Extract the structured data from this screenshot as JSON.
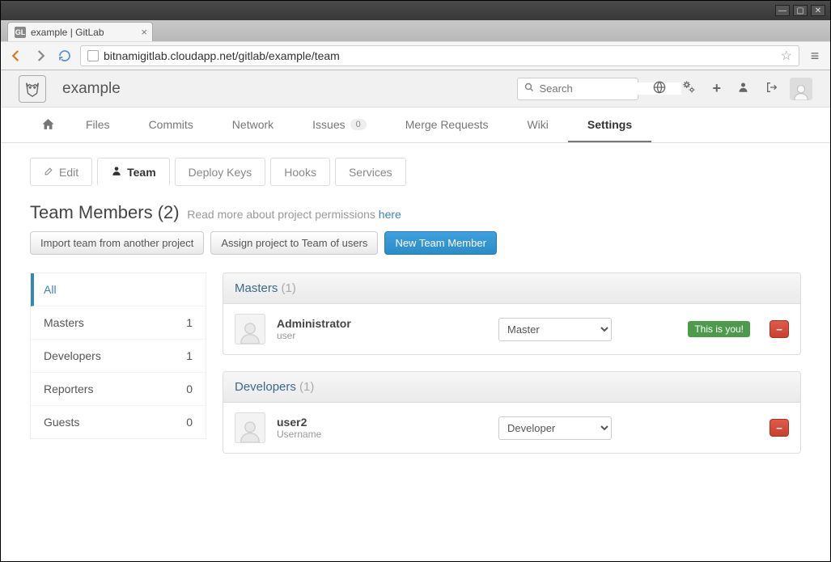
{
  "browser": {
    "tab_title": "example | GitLab",
    "favicon_text": "GL",
    "url_display": "bitnamigitlab.cloudapp.net/gitlab/example/team"
  },
  "header": {
    "project_name": "example",
    "search_placeholder": "Search"
  },
  "nav": {
    "items": [
      "Files",
      "Commits",
      "Network",
      "Issues",
      "Merge Requests",
      "Wiki",
      "Settings"
    ],
    "issues_count": "0",
    "active": "Settings"
  },
  "subtabs": {
    "edit": "Edit",
    "team": "Team",
    "deploy_keys": "Deploy Keys",
    "hooks": "Hooks",
    "services": "Services"
  },
  "heading": {
    "title": "Team Members",
    "count": "(2)",
    "hint_prefix": "Read more about project permissions ",
    "hint_link": "here"
  },
  "buttons": {
    "import": "Import team from another project",
    "assign": "Assign project to Team of users",
    "new_member": "New Team Member"
  },
  "sidebar": {
    "items": [
      {
        "label": "All",
        "count": ""
      },
      {
        "label": "Masters",
        "count": "1"
      },
      {
        "label": "Developers",
        "count": "1"
      },
      {
        "label": "Reporters",
        "count": "0"
      },
      {
        "label": "Guests",
        "count": "0"
      }
    ]
  },
  "groups": [
    {
      "title": "Masters",
      "count": "(1)",
      "members": [
        {
          "name": "Administrator",
          "sub": "user",
          "role": "Master",
          "you": true
        }
      ]
    },
    {
      "title": "Developers",
      "count": "(1)",
      "members": [
        {
          "name": "user2",
          "sub": "Username",
          "role": "Developer",
          "you": false
        }
      ]
    }
  ],
  "labels": {
    "this_is_you": "This is you!"
  }
}
